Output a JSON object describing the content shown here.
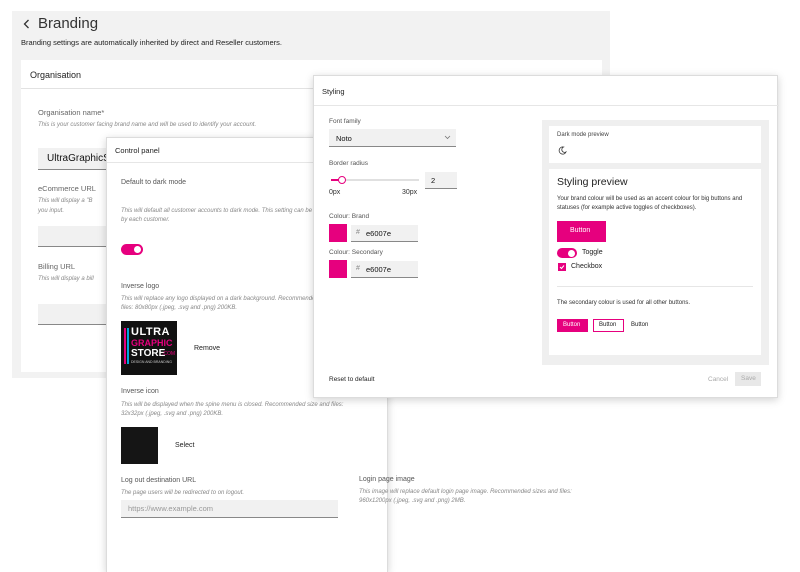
{
  "branding": {
    "back_icon": "chevron-left-icon",
    "title": "Branding",
    "subtitle": "Branding settings are automatically inherited by direct and Reseller customers.",
    "organisation_header": "Organisation",
    "org_name_label": "Organisation name*",
    "org_name_hint": "This is your customer facing brand name and will be used to identify your account.",
    "org_name_value": "UltraGraphicSt",
    "ecommerce_label": "eCommerce URL",
    "ecommerce_hint": "This will display a \"B",
    "ecommerce_hint2": "you input.",
    "billing_label": "Billing URL",
    "billing_hint": "This will display a bill"
  },
  "control_panel": {
    "title": "Control panel",
    "dark_mode_label": "Default to dark mode",
    "dark_mode_hint": "This will default all customer accounts to dark mode. This setting can be o",
    "dark_mode_hint2": "by each customer.",
    "inverse_logo_label": "Inverse logo",
    "inverse_logo_hint": "This will replace any logo displayed on a dark background. Recommendec",
    "inverse_logo_hint2": "files: 80x80px (.jpeg, .svg and .png) 200KB.",
    "logo_line1": "ULTRA",
    "logo_line2": "GRAPHIC",
    "logo_line3": "STORE",
    "logo_line3b": ".COM",
    "logo_line4": "DESIGN AND BRANDING",
    "remove_label": "Remove",
    "inverse_icon_label": "Inverse icon",
    "inverse_icon_hint": "This will be displayed when the spine menu is closed. Recommended size and files:",
    "inverse_icon_hint2": "32x32px (.jpeg, .svg and .png) 200KB.",
    "select_label": "Select",
    "logout_label": "Log out destination URL",
    "logout_hint": "The page users will be redirected to on logout.",
    "logout_placeholder": "https://www.example.com",
    "login_image_label": "Login page image",
    "login_image_hint": "This image will replace default login page image. Recommended sizes and files:",
    "login_image_hint2": "960x1200px (.jpeg, .svg and .png) 2MB."
  },
  "styling": {
    "title": "Styling",
    "font_family_label": "Font family",
    "font_family_value": "Noto",
    "font_dropdown_icon": "chevron-down-icon",
    "border_radius_label": "Border radius",
    "border_radius_value": "2",
    "border_radius_fraction": 0.12,
    "slider_min": "0px",
    "slider_max": "30px",
    "brand_label": "Colour: Brand",
    "brand_hash": "#",
    "brand_value": "e6007e",
    "secondary_label": "Colour: Secondary",
    "secondary_hash": "#",
    "secondary_value": "e6007e",
    "brand_color": "#e6007e",
    "secondary_color": "#e6007e",
    "reset_label": "Reset to default",
    "cancel_label": "Cancel",
    "save_label": "Save",
    "dark_preview_label": "Dark mode preview",
    "moon_icon": "moon-icon",
    "preview_title": "Styling preview",
    "preview_text": "Your brand colour will be used as an accent colour for big buttons and statuses (for example active toggles of checkboxes).",
    "preview_button": "Button",
    "toggle_label": "Toggle",
    "checkbox_label": "Checkbox",
    "secondary_text": "The secondary colour is used for all other buttons.",
    "btn_primary": "Button",
    "btn_outline": "Button",
    "btn_text": "Button"
  }
}
